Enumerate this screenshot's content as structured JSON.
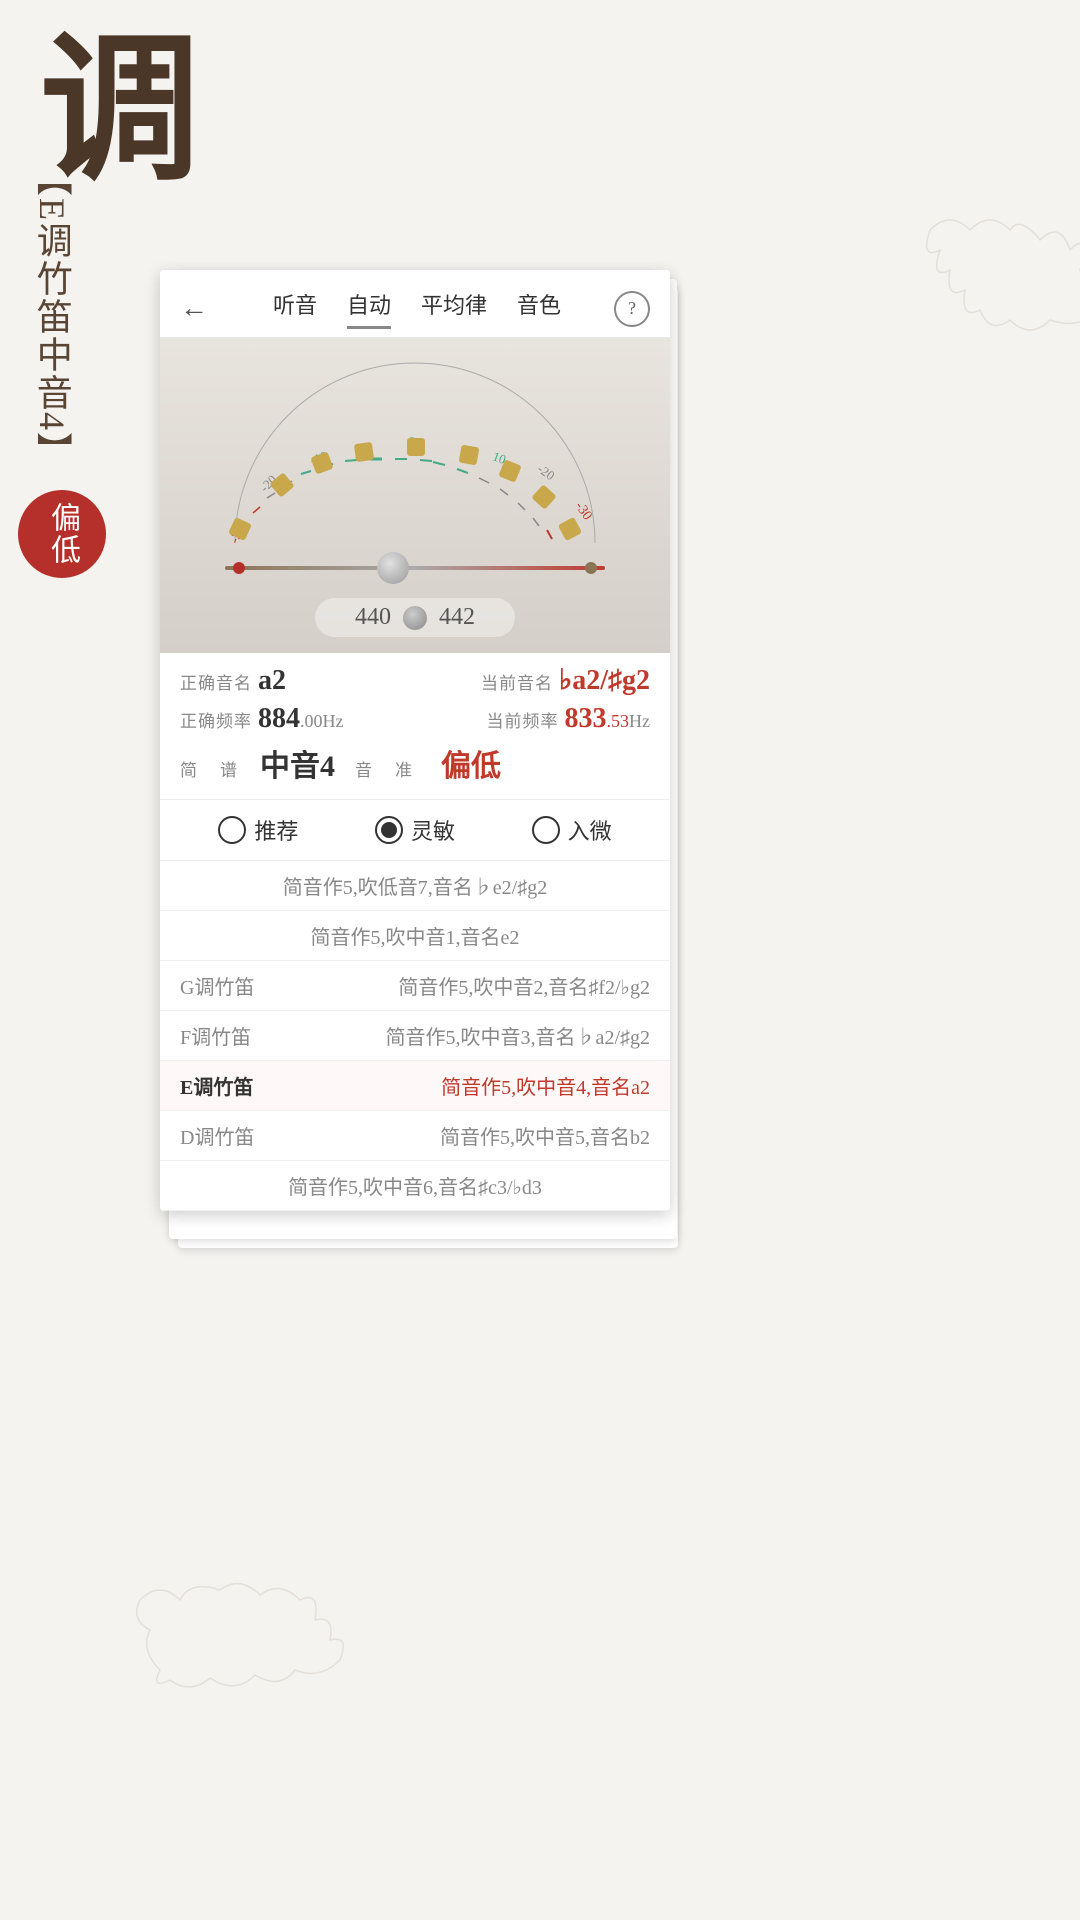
{
  "title_char": "调",
  "vertical_label": "E调竹笛中音4",
  "status_badge": "偏低",
  "nav": {
    "back": "←",
    "items": [
      "听音",
      "自动",
      "平均律",
      "音色"
    ],
    "active_index": 1,
    "help": "?"
  },
  "gauge": {
    "tick_labels_green": [
      "-10",
      "0",
      "10"
    ],
    "tick_labels_outer": [
      "-20",
      "-20"
    ],
    "tick_labels_red": [
      "-30"
    ]
  },
  "needle": {
    "position_pct": 40
  },
  "frequency_ref": {
    "left": "440",
    "right": "442"
  },
  "info": {
    "correct_note_label": "正确音名",
    "correct_note_value": "a2",
    "current_note_label": "当前音名",
    "current_note_value": "♭a2/♯g2",
    "correct_freq_label": "正确频率",
    "correct_freq_main": "884",
    "correct_freq_decimal": ".00",
    "correct_freq_unit": "Hz",
    "current_freq_label": "当前频率",
    "current_freq_main": "833",
    "current_freq_decimal": ".53",
    "current_freq_unit": "Hz",
    "solfege_label": "简　谱",
    "solfege_value": "中音4",
    "tuning_label": "音　准",
    "tuning_value": "偏低"
  },
  "radio_options": [
    {
      "label": "推荐",
      "checked": false
    },
    {
      "label": "灵敏",
      "checked": true
    },
    {
      "label": "入微",
      "checked": false
    }
  ],
  "list_rows": [
    {
      "instrument": "",
      "desc": "简音作5,吹低音7,音名♭e2/♯g2",
      "highlight": false,
      "single": true
    },
    {
      "instrument": "",
      "desc": "简音作5,吹中音1,音名e2",
      "highlight": false,
      "single": true
    },
    {
      "instrument": "G调竹笛",
      "desc": "简音作5,吹中音2,音名♯f2/♭g2",
      "highlight": false
    },
    {
      "instrument": "F调竹笛",
      "desc": "简音作5,吹中音3,音名♭a2/♯g2",
      "highlight": false
    },
    {
      "instrument": "E调竹笛",
      "desc": "简音作5,吹中音4,音名a2",
      "highlight": true
    },
    {
      "instrument": "D调竹笛",
      "desc": "简音作5,吹中音5,音名b2",
      "highlight": false
    },
    {
      "instrument": "",
      "desc": "简音作5,吹中音6,音名♯c3/♭d3",
      "highlight": false,
      "single": true
    }
  ]
}
